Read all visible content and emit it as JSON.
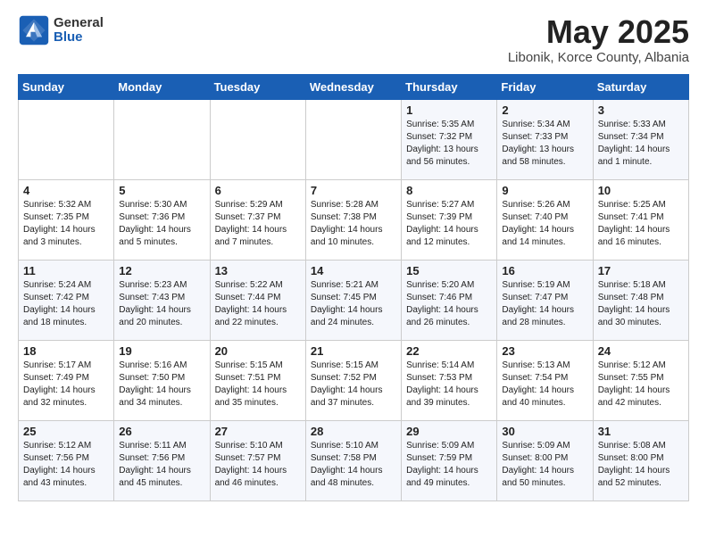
{
  "header": {
    "logo_general": "General",
    "logo_blue": "Blue",
    "month_title": "May 2025",
    "location": "Libonik, Korce County, Albania"
  },
  "weekdays": [
    "Sunday",
    "Monday",
    "Tuesday",
    "Wednesday",
    "Thursday",
    "Friday",
    "Saturday"
  ],
  "weeks": [
    [
      {
        "day": "",
        "info": ""
      },
      {
        "day": "",
        "info": ""
      },
      {
        "day": "",
        "info": ""
      },
      {
        "day": "",
        "info": ""
      },
      {
        "day": "1",
        "info": "Sunrise: 5:35 AM\nSunset: 7:32 PM\nDaylight: 13 hours\nand 56 minutes."
      },
      {
        "day": "2",
        "info": "Sunrise: 5:34 AM\nSunset: 7:33 PM\nDaylight: 13 hours\nand 58 minutes."
      },
      {
        "day": "3",
        "info": "Sunrise: 5:33 AM\nSunset: 7:34 PM\nDaylight: 14 hours\nand 1 minute."
      }
    ],
    [
      {
        "day": "4",
        "info": "Sunrise: 5:32 AM\nSunset: 7:35 PM\nDaylight: 14 hours\nand 3 minutes."
      },
      {
        "day": "5",
        "info": "Sunrise: 5:30 AM\nSunset: 7:36 PM\nDaylight: 14 hours\nand 5 minutes."
      },
      {
        "day": "6",
        "info": "Sunrise: 5:29 AM\nSunset: 7:37 PM\nDaylight: 14 hours\nand 7 minutes."
      },
      {
        "day": "7",
        "info": "Sunrise: 5:28 AM\nSunset: 7:38 PM\nDaylight: 14 hours\nand 10 minutes."
      },
      {
        "day": "8",
        "info": "Sunrise: 5:27 AM\nSunset: 7:39 PM\nDaylight: 14 hours\nand 12 minutes."
      },
      {
        "day": "9",
        "info": "Sunrise: 5:26 AM\nSunset: 7:40 PM\nDaylight: 14 hours\nand 14 minutes."
      },
      {
        "day": "10",
        "info": "Sunrise: 5:25 AM\nSunset: 7:41 PM\nDaylight: 14 hours\nand 16 minutes."
      }
    ],
    [
      {
        "day": "11",
        "info": "Sunrise: 5:24 AM\nSunset: 7:42 PM\nDaylight: 14 hours\nand 18 minutes."
      },
      {
        "day": "12",
        "info": "Sunrise: 5:23 AM\nSunset: 7:43 PM\nDaylight: 14 hours\nand 20 minutes."
      },
      {
        "day": "13",
        "info": "Sunrise: 5:22 AM\nSunset: 7:44 PM\nDaylight: 14 hours\nand 22 minutes."
      },
      {
        "day": "14",
        "info": "Sunrise: 5:21 AM\nSunset: 7:45 PM\nDaylight: 14 hours\nand 24 minutes."
      },
      {
        "day": "15",
        "info": "Sunrise: 5:20 AM\nSunset: 7:46 PM\nDaylight: 14 hours\nand 26 minutes."
      },
      {
        "day": "16",
        "info": "Sunrise: 5:19 AM\nSunset: 7:47 PM\nDaylight: 14 hours\nand 28 minutes."
      },
      {
        "day": "17",
        "info": "Sunrise: 5:18 AM\nSunset: 7:48 PM\nDaylight: 14 hours\nand 30 minutes."
      }
    ],
    [
      {
        "day": "18",
        "info": "Sunrise: 5:17 AM\nSunset: 7:49 PM\nDaylight: 14 hours\nand 32 minutes."
      },
      {
        "day": "19",
        "info": "Sunrise: 5:16 AM\nSunset: 7:50 PM\nDaylight: 14 hours\nand 34 minutes."
      },
      {
        "day": "20",
        "info": "Sunrise: 5:15 AM\nSunset: 7:51 PM\nDaylight: 14 hours\nand 35 minutes."
      },
      {
        "day": "21",
        "info": "Sunrise: 5:15 AM\nSunset: 7:52 PM\nDaylight: 14 hours\nand 37 minutes."
      },
      {
        "day": "22",
        "info": "Sunrise: 5:14 AM\nSunset: 7:53 PM\nDaylight: 14 hours\nand 39 minutes."
      },
      {
        "day": "23",
        "info": "Sunrise: 5:13 AM\nSunset: 7:54 PM\nDaylight: 14 hours\nand 40 minutes."
      },
      {
        "day": "24",
        "info": "Sunrise: 5:12 AM\nSunset: 7:55 PM\nDaylight: 14 hours\nand 42 minutes."
      }
    ],
    [
      {
        "day": "25",
        "info": "Sunrise: 5:12 AM\nSunset: 7:56 PM\nDaylight: 14 hours\nand 43 minutes."
      },
      {
        "day": "26",
        "info": "Sunrise: 5:11 AM\nSunset: 7:56 PM\nDaylight: 14 hours\nand 45 minutes."
      },
      {
        "day": "27",
        "info": "Sunrise: 5:10 AM\nSunset: 7:57 PM\nDaylight: 14 hours\nand 46 minutes."
      },
      {
        "day": "28",
        "info": "Sunrise: 5:10 AM\nSunset: 7:58 PM\nDaylight: 14 hours\nand 48 minutes."
      },
      {
        "day": "29",
        "info": "Sunrise: 5:09 AM\nSunset: 7:59 PM\nDaylight: 14 hours\nand 49 minutes."
      },
      {
        "day": "30",
        "info": "Sunrise: 5:09 AM\nSunset: 8:00 PM\nDaylight: 14 hours\nand 50 minutes."
      },
      {
        "day": "31",
        "info": "Sunrise: 5:08 AM\nSunset: 8:00 PM\nDaylight: 14 hours\nand 52 minutes."
      }
    ]
  ]
}
